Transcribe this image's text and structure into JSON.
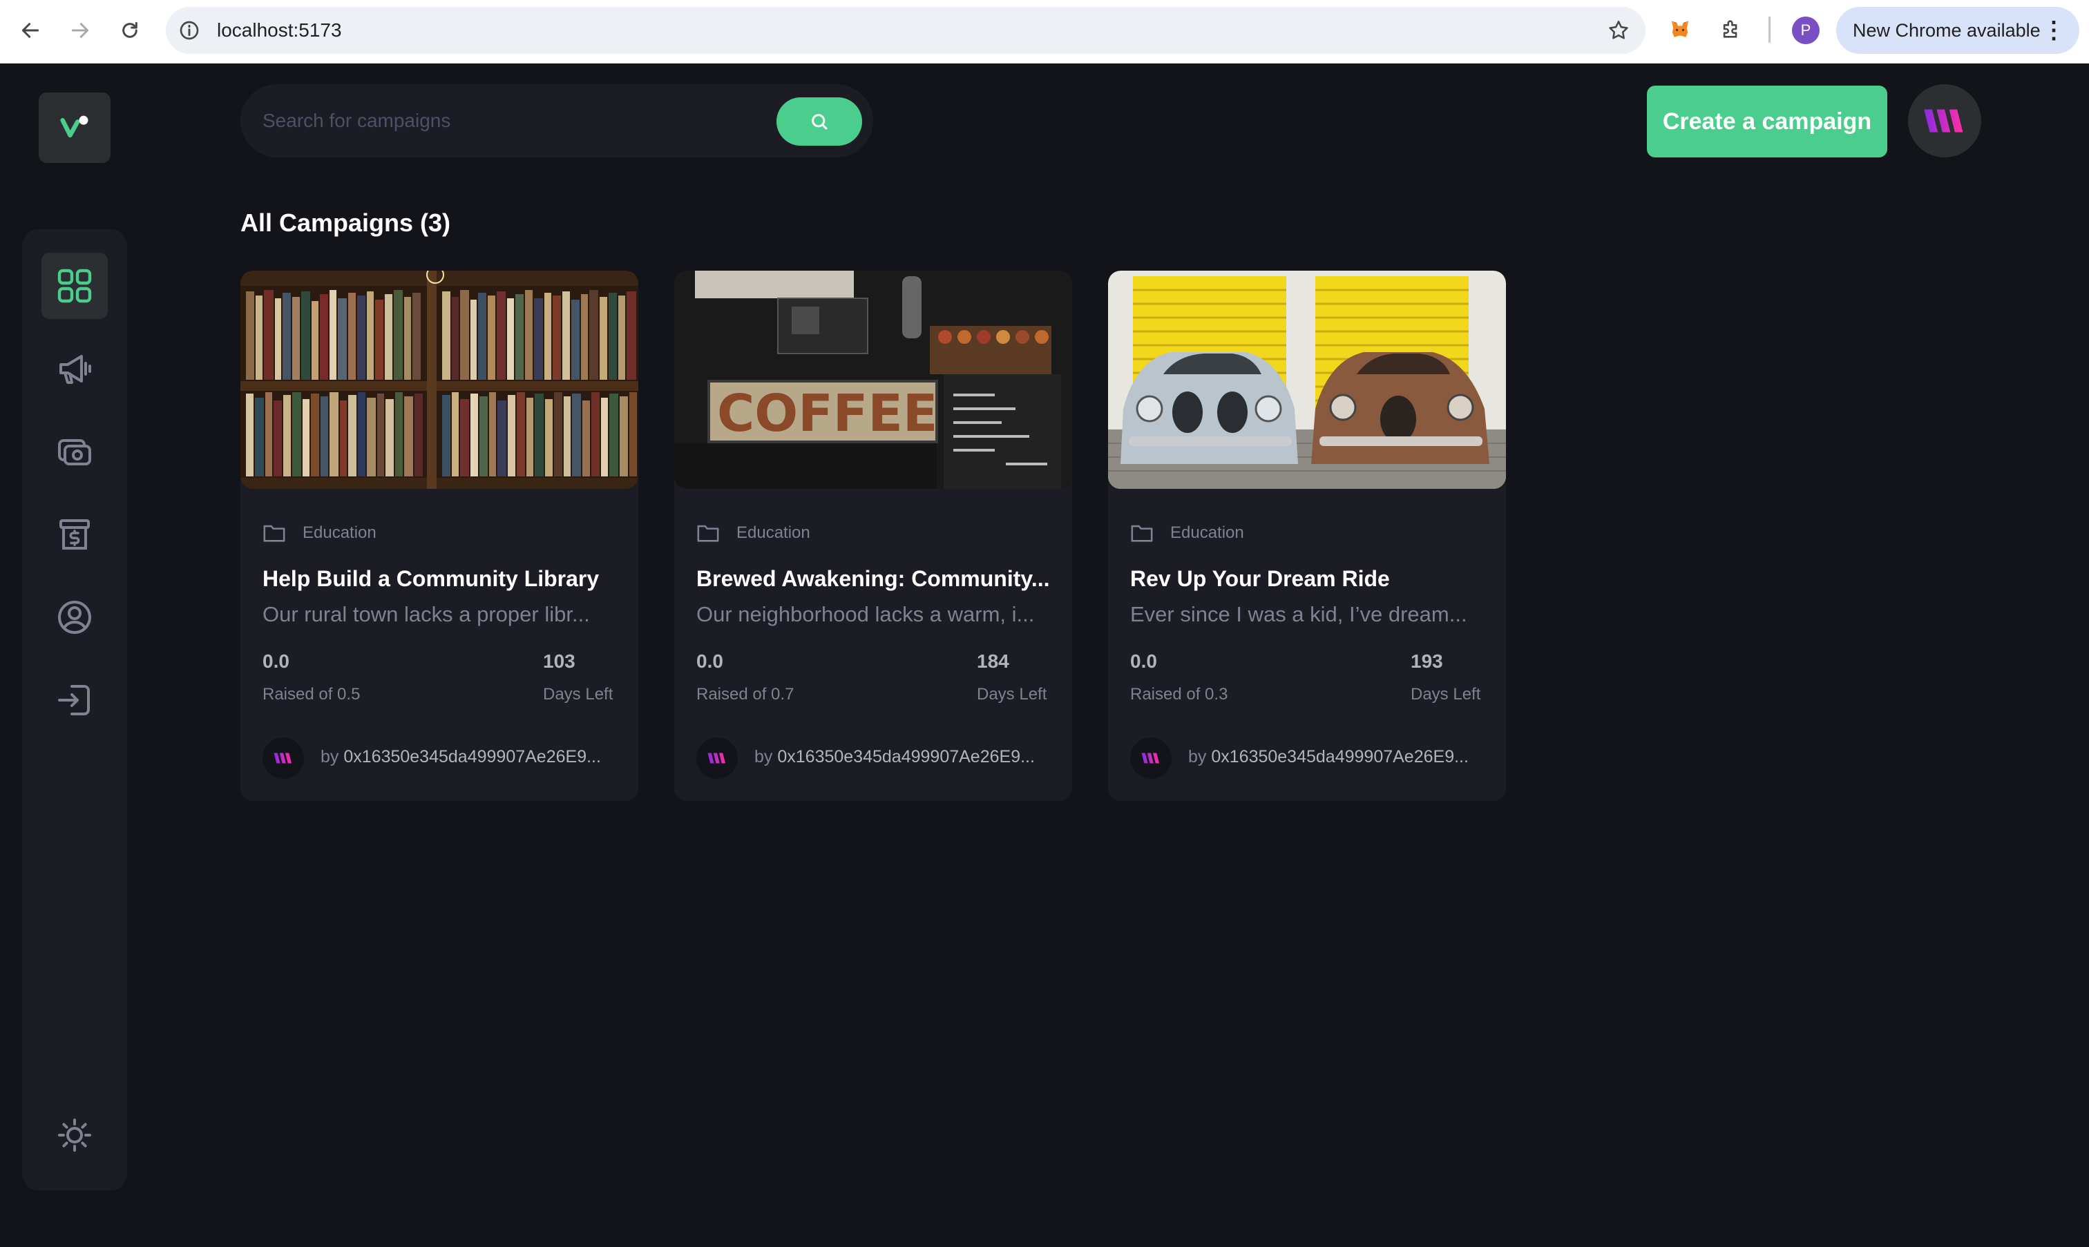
{
  "browser": {
    "url": "localhost:5173",
    "profile_initial": "P",
    "update_label": "New Chrome available",
    "menu_glyph": "⋮"
  },
  "header": {
    "search_placeholder": "Search for campaigns",
    "create_button_label": "Create a campaign"
  },
  "page": {
    "title": "All Campaigns (3)"
  },
  "sidebar": {
    "items": [
      {
        "name": "dashboard",
        "icon": "grid-icon",
        "active": true
      },
      {
        "name": "campaign",
        "icon": "megaphone-icon"
      },
      {
        "name": "payment",
        "icon": "payment-icon"
      },
      {
        "name": "withdraw",
        "icon": "withdraw-icon"
      },
      {
        "name": "profile",
        "icon": "profile-icon"
      },
      {
        "name": "logout",
        "icon": "logout-icon"
      }
    ],
    "theme_icon": "sun-icon"
  },
  "colors": {
    "accent": "#4acd8d",
    "background": "#13131a",
    "card": "#1c1c24",
    "muted": "#808191"
  },
  "campaigns": [
    {
      "category": "Education",
      "title": "Help Build a Community Library",
      "description": "Our rural town lacks a proper libr...",
      "raised": "0.0",
      "raised_label": "Raised of 0.5",
      "days": "103",
      "days_label": "Days Left",
      "owner_prefix": "by",
      "owner": "0x16350e345da499907Ae26E9..."
    },
    {
      "category": "Education",
      "title": "Brewed Awakening: Community...",
      "description": "Our neighborhood lacks a warm, i...",
      "raised": "0.0",
      "raised_label": "Raised of 0.7",
      "days": "184",
      "days_label": "Days Left",
      "owner_prefix": "by",
      "owner": "0x16350e345da499907Ae26E9...",
      "image_text": "COFFEE"
    },
    {
      "category": "Education",
      "title": "Rev Up Your Dream Ride",
      "description": "Ever since I was a kid, I’ve dream...",
      "raised": "0.0",
      "raised_label": "Raised of 0.3",
      "days": "193",
      "days_label": "Days Left",
      "owner_prefix": "by",
      "owner": "0x16350e345da499907Ae26E9..."
    }
  ]
}
